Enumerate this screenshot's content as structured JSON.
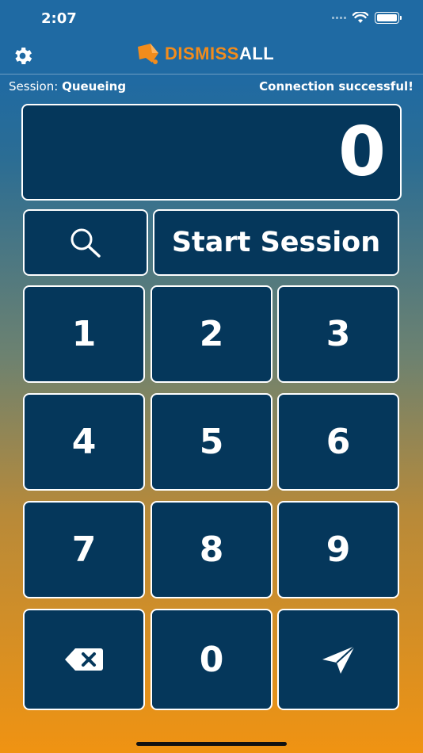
{
  "status_bar": {
    "time": "2:07"
  },
  "header": {
    "logo_part1": "DISMISS",
    "logo_part2": "ALL"
  },
  "info": {
    "session_prefix": "Session: ",
    "session_status": "Queueing",
    "connection_text": "Connection successful!"
  },
  "display": {
    "value": "0"
  },
  "actions": {
    "start_label": "Start Session"
  },
  "keypad": {
    "k1": "1",
    "k2": "2",
    "k3": "3",
    "k4": "4",
    "k5": "5",
    "k6": "6",
    "k7": "7",
    "k8": "8",
    "k9": "9",
    "k0": "0"
  },
  "colors": {
    "tile": "#05375b",
    "accent": "#f28c1c",
    "top": "#1f6aa3",
    "bottom": "#f09312"
  }
}
